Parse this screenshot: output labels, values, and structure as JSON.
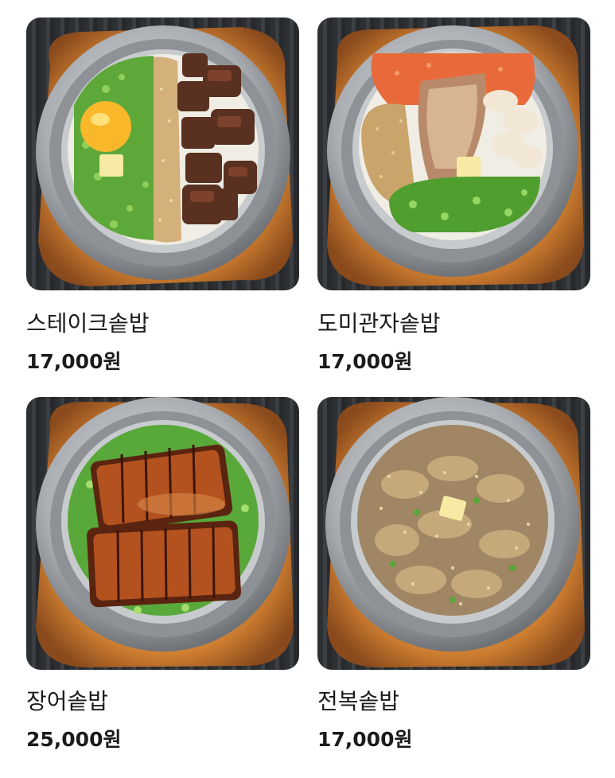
{
  "menu": {
    "items": [
      {
        "name": "스테이크솥밥",
        "price": "17,000원",
        "photo_icon": "steak-rice-pot-photo"
      },
      {
        "name": "도미관자솥밥",
        "price": "17,000원",
        "photo_icon": "sea-bream-scallop-rice-pot-photo"
      },
      {
        "name": "장어솥밥",
        "price": "25,000원",
        "photo_icon": "eel-rice-pot-photo"
      },
      {
        "name": "전복솥밥",
        "price": "17,000원",
        "photo_icon": "abalone-rice-pot-photo"
      }
    ]
  },
  "colors": {
    "text": "#1b1b1b",
    "background": "#ffffff",
    "wood_board": "#d98a3a",
    "pot_steel": "#b9bcbf"
  }
}
